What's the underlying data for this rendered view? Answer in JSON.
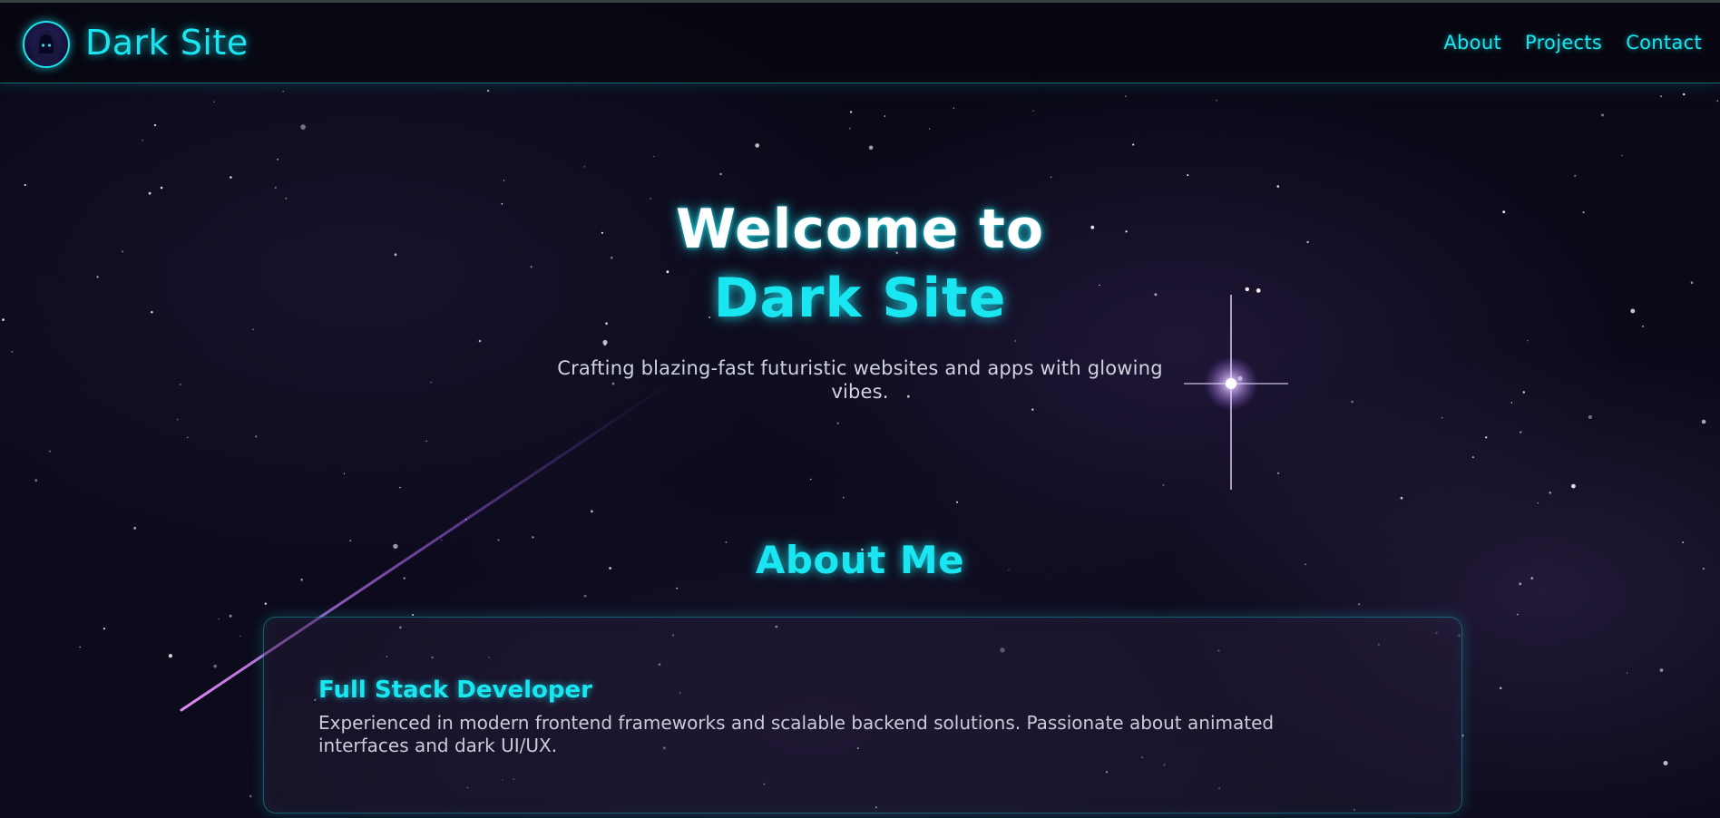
{
  "header": {
    "brand": "Dark Site",
    "logo_icon": "hooded-figure-avatar-icon",
    "nav": [
      "About",
      "Projects",
      "Contact"
    ]
  },
  "hero": {
    "line1": "Welcome to",
    "line2": "Dark Site",
    "tagline": "Crafting blazing-fast futuristic websites and apps with glowing vibes."
  },
  "about": {
    "title": "About Me",
    "card": {
      "title": "Full Stack Developer",
      "text": "Experienced in modern frontend frameworks and scalable backend solutions. Passionate about animated interfaces and dark UI/UX."
    }
  },
  "colors": {
    "accent": "#19e6f0",
    "background": "#090816",
    "text": "#cfd3e0",
    "meteor": "#d07cf0"
  }
}
